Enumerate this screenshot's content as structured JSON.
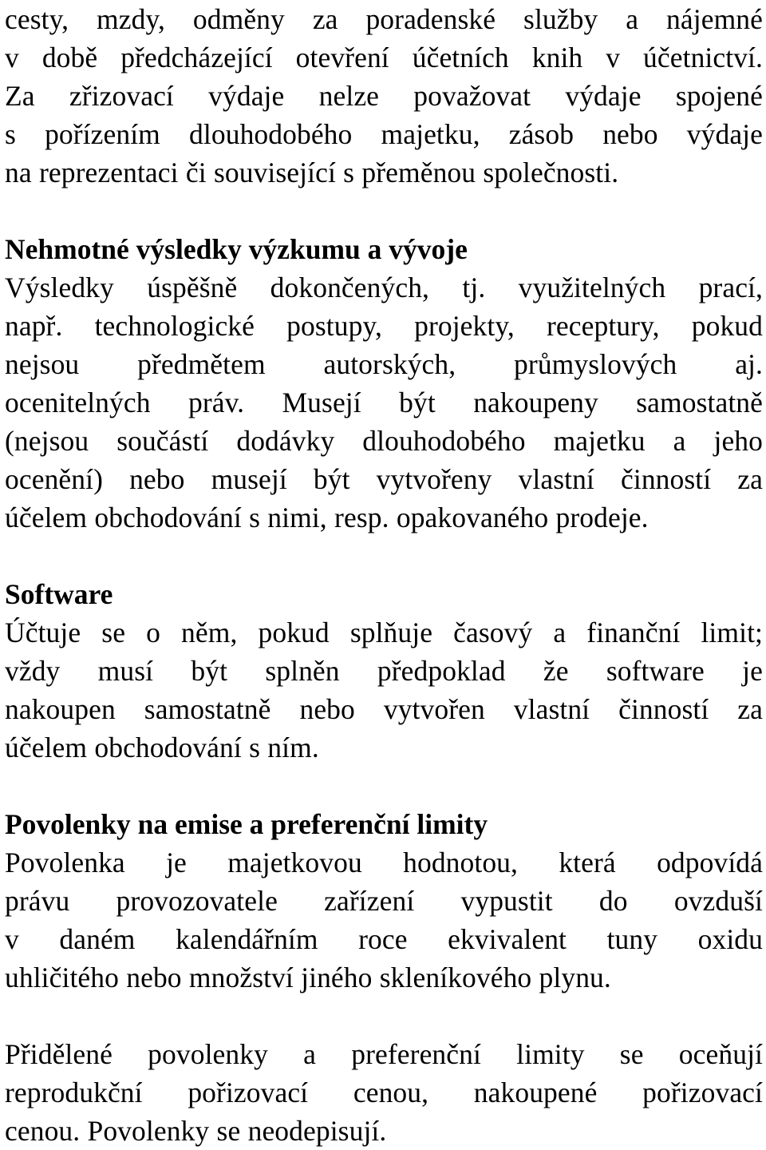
{
  "document": {
    "language": "cs",
    "page_background": "#ffffff",
    "text_color": "#000000",
    "blocks": [
      {
        "type": "paragraph",
        "name": "paragraph-zrizovaci-vydaje",
        "lines": [
          "cesty, mzdy, odměny za poradenské služby a nájemné",
          "v době předcházející otevření účetních knih v účetnictví.",
          "Za zřizovací výdaje nelze považovat výdaje spojené",
          "s pořízením dlouhodobého majetku, zásob nebo výdaje",
          "na reprezentaci či související s přeměnou společnosti."
        ]
      },
      {
        "type": "heading",
        "name": "heading-nehmotne-vysledky",
        "text": "Nehmotné výsledky výzkumu a vývoje"
      },
      {
        "type": "paragraph",
        "name": "paragraph-nehmotne-vysledky",
        "lines": [
          "Výsledky úspěšně dokončených, tj. využitelných prací,",
          "např. technologické postupy, projekty, receptury, pokud",
          "nejsou předmětem autorských, průmyslových aj.",
          "ocenitelných práv. Musejí být nakoupeny samostatně",
          "(nejsou součástí dodávky dlouhodobého majetku a jeho",
          "ocenění) nebo musejí být vytvořeny vlastní činností za",
          "účelem obchodování s nimi, resp. opakovaného prodeje."
        ]
      },
      {
        "type": "heading",
        "name": "heading-software",
        "text": "Software"
      },
      {
        "type": "paragraph",
        "name": "paragraph-software",
        "lines": [
          "Účtuje se o něm, pokud splňuje časový a finanční limit;",
          "vždy musí být splněn předpoklad že software je",
          "nakoupen samostatně nebo vytvořen vlastní činností za",
          "účelem obchodování s ním."
        ]
      },
      {
        "type": "heading",
        "name": "heading-povolenky-na-emise",
        "text": "Povolenky na emise a preferenční limity"
      },
      {
        "type": "paragraph",
        "name": "paragraph-povolenka-definice",
        "lines": [
          "Povolenka je majetkovou hodnotou, která odpovídá",
          "právu provozovatele zařízení vypustit do ovzduší",
          "v daném kalendářním roce ekvivalent tuny oxidu",
          "uhličitého nebo množství jiného skleníkového plynu."
        ]
      },
      {
        "type": "paragraph",
        "name": "paragraph-prideleleme-povolenky",
        "lines": [
          "Přidělené povolenky a preferenční limity se oceňují",
          "reprodukční pořizovací cenou, nakoupené pořizovací",
          "cenou. Povolenky se neodepisují."
        ]
      }
    ]
  }
}
